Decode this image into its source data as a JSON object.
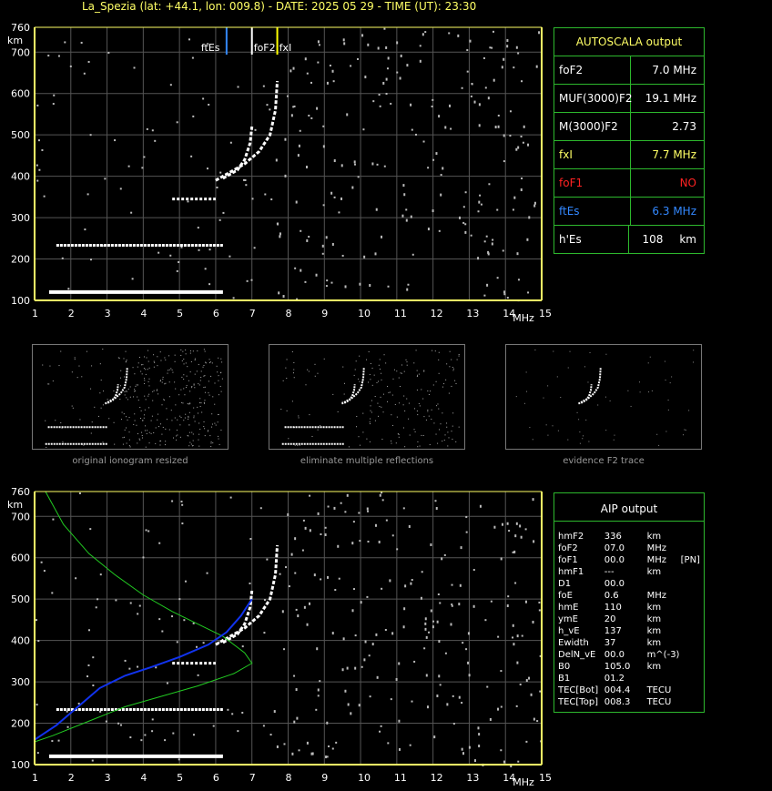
{
  "header": "La_Spezia (lat: +44.1, lon: 009.8) - DATE: 2025 05 29 - TIME (UT): 23:30",
  "colors": {
    "axis": "#ffff66",
    "grid": "#555555",
    "panel_border": "#2db82d",
    "fxl": "#ffff00",
    "ftes": "#3388ff",
    "fof1": "#ff2222",
    "green_curve": "#22cc22",
    "blue_curve": "#1133ee"
  },
  "chart_data": [
    {
      "type": "scatter",
      "title": "",
      "xlabel": "MHz",
      "ylabel": "km",
      "xlim": [
        1,
        15
      ],
      "ylim": [
        100,
        760
      ],
      "x_ticks": [
        "1",
        "2",
        "3",
        "4",
        "5",
        "6",
        "7",
        "8",
        "9",
        "10",
        "11",
        "12",
        "13",
        "14",
        "15"
      ],
      "y_ticks": [
        "100",
        "200",
        "300",
        "400",
        "500",
        "600",
        "700",
        "760"
      ],
      "markers": [
        {
          "name": "ftEs",
          "x": 6.3,
          "color": "#3388ff"
        },
        {
          "name": "foF2",
          "x": 7.0,
          "color": "#ffffff"
        },
        {
          "name": "fxI",
          "x": 7.7,
          "color": "#ffff00"
        }
      ],
      "traces": {
        "es_first": {
          "x_start": 1.4,
          "x_end": 6.2,
          "h": 120
        },
        "es_second": {
          "x_start": 1.6,
          "x_end": 6.2,
          "h": 233
        },
        "f2_o": [
          [
            6.2,
            395
          ],
          [
            6.6,
            415
          ],
          [
            6.8,
            440
          ],
          [
            6.95,
            480
          ],
          [
            7.0,
            520
          ]
        ],
        "f2_x": [
          [
            6.0,
            390
          ],
          [
            6.4,
            410
          ],
          [
            6.8,
            430
          ],
          [
            7.2,
            460
          ],
          [
            7.5,
            500
          ],
          [
            7.65,
            560
          ],
          [
            7.7,
            630
          ]
        ],
        "e_region": {
          "x_start": 4.8,
          "x_end": 6.0,
          "h": 345
        }
      }
    },
    {
      "type": "line",
      "title": "",
      "xlabel": "MHz",
      "ylabel": "km",
      "xlim": [
        1,
        15
      ],
      "ylim": [
        100,
        760
      ],
      "x_ticks": [
        "1",
        "2",
        "3",
        "4",
        "5",
        "6",
        "7",
        "8",
        "9",
        "10",
        "11",
        "12",
        "13",
        "14",
        "15"
      ],
      "y_ticks": [
        "100",
        "200",
        "300",
        "400",
        "500",
        "600",
        "700",
        "760"
      ],
      "series": [
        {
          "color": "#22cc22",
          "points": [
            [
              1.3,
              760
            ],
            [
              1.8,
              680
            ],
            [
              2.5,
              610
            ],
            [
              3.2,
              560
            ],
            [
              4.0,
              510
            ],
            [
              4.8,
              470
            ],
            [
              5.5,
              440
            ],
            [
              6.2,
              410
            ],
            [
              6.8,
              370
            ],
            [
              7.0,
              345
            ],
            [
              6.5,
              320
            ],
            [
              5.5,
              290
            ],
            [
              4.5,
              265
            ],
            [
              3.5,
              240
            ],
            [
              2.5,
              205
            ],
            [
              1.5,
              170
            ],
            [
              1.0,
              155
            ]
          ]
        },
        {
          "color": "#1133ee",
          "points": [
            [
              1.0,
              160
            ],
            [
              1.6,
              195
            ],
            [
              2.2,
              240
            ],
            [
              2.8,
              285
            ],
            [
              3.5,
              315
            ],
            [
              4.2,
              335
            ],
            [
              5.0,
              360
            ],
            [
              5.8,
              390
            ],
            [
              6.3,
              420
            ],
            [
              6.7,
              460
            ],
            [
              7.0,
              500
            ]
          ]
        }
      ]
    }
  ],
  "autoscala": {
    "title": "AUTOSCALA output",
    "rows": [
      {
        "key": "foF2",
        "value": "7.0 MHz",
        "color": "#ffffff"
      },
      {
        "key": "MUF(3000)F2",
        "value": "19.1 MHz",
        "color": "#ffffff"
      },
      {
        "key": "M(3000)F2",
        "value": "2.73",
        "color": "#ffffff"
      },
      {
        "key": "fxI",
        "value": "7.7 MHz",
        "color": "#ffff66"
      },
      {
        "key": "foF1",
        "value": "NO",
        "color": "#ff2222"
      },
      {
        "key": "ftEs",
        "value": "6.3 MHz",
        "color": "#3388ff"
      },
      {
        "key": "h'Es",
        "value": "108",
        "unit": "km",
        "color": "#ffffff"
      }
    ]
  },
  "thumbnails": [
    {
      "caption": "original ionogram resized"
    },
    {
      "caption": "eliminate multiple reflections"
    },
    {
      "caption": "evidence F2 trace"
    }
  ],
  "aip": {
    "title": "AIP output",
    "rows": [
      [
        "hmF2",
        "336",
        "km",
        ""
      ],
      [
        "foF2",
        "07.0",
        "MHz",
        ""
      ],
      [
        "foF1",
        "00.0",
        "MHz",
        "[PN]"
      ],
      [
        "hmF1",
        "---",
        "km",
        ""
      ],
      [
        "D1",
        "00.0",
        "",
        ""
      ],
      [
        "foE",
        "0.6",
        "MHz",
        ""
      ],
      [
        "hmE",
        "110",
        "km",
        ""
      ],
      [
        "ymE",
        "20",
        "km",
        ""
      ],
      [
        "h_vE",
        "137",
        "km",
        ""
      ],
      [
        "Ewidth",
        "37",
        "km",
        ""
      ],
      [
        "DelN_vE",
        "00.0",
        "m^(-3)",
        ""
      ],
      [
        "B0",
        "105.0",
        "km",
        ""
      ],
      [
        "B1",
        "01.2",
        "",
        ""
      ],
      [
        "TEC[Bot]",
        "004.4",
        "TECU",
        ""
      ],
      [
        "TEC[Top]",
        "008.3",
        "TECU",
        ""
      ]
    ]
  }
}
